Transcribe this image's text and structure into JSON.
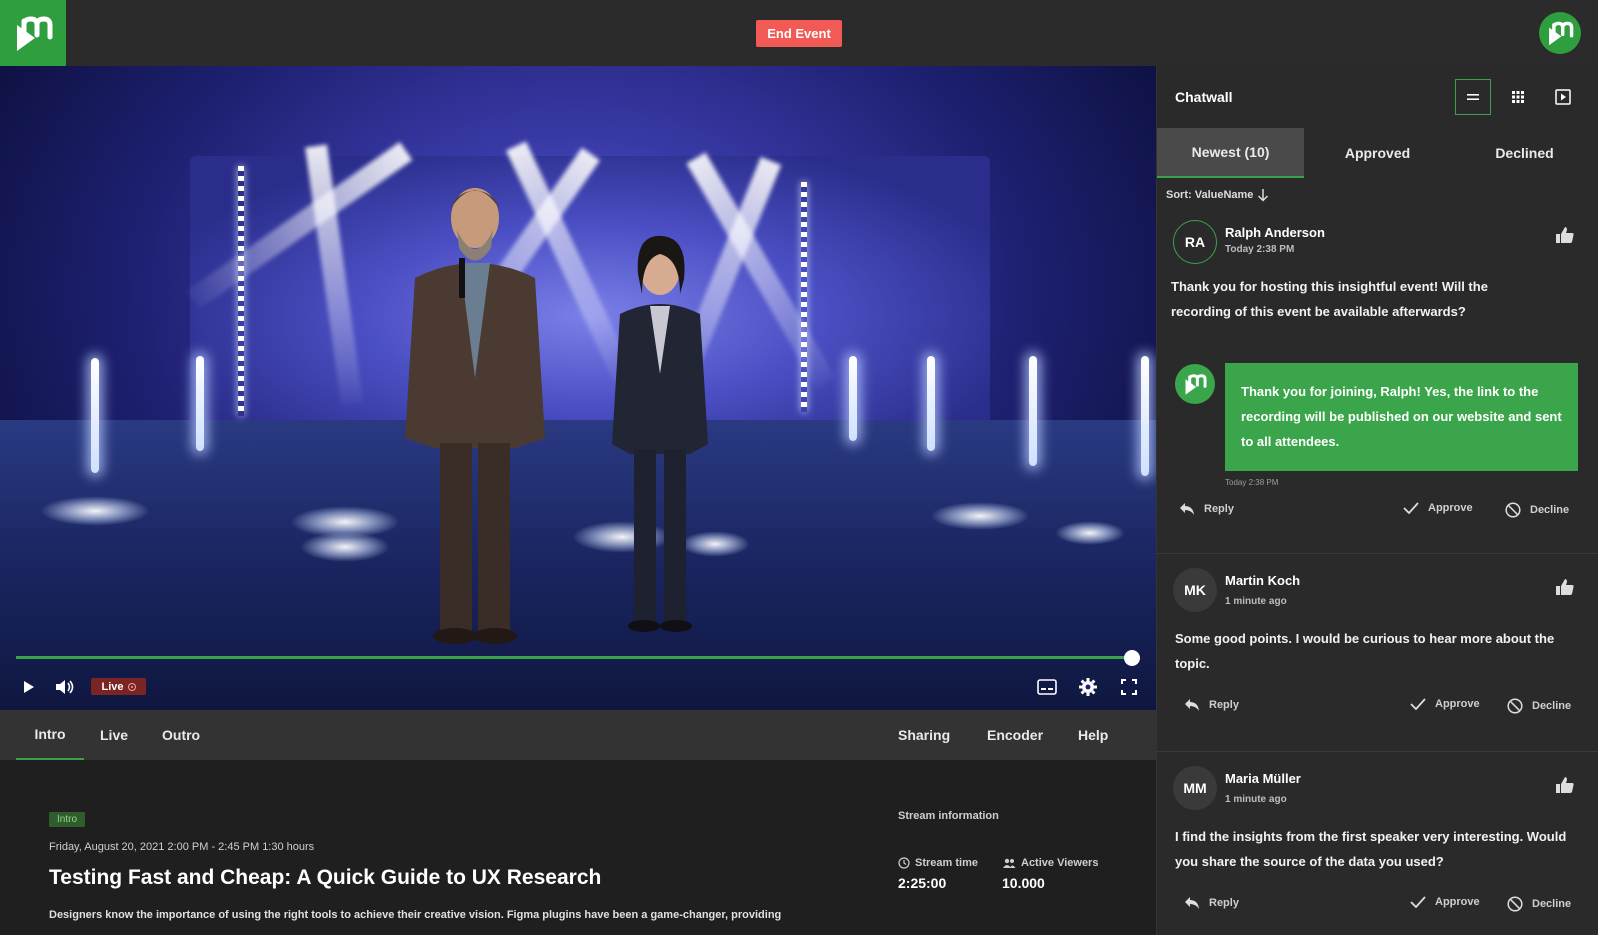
{
  "topbar": {
    "end_event_label": "End Event",
    "accent": "#2e9e3e",
    "end_color": "#f25a55"
  },
  "player": {
    "live_label": "Live",
    "progress": 0.99
  },
  "subnav": {
    "left_tabs": [
      "Intro",
      "Live",
      "Outro"
    ],
    "right_tabs": [
      "Sharing",
      "Encoder",
      "Help"
    ],
    "active": "Intro"
  },
  "event": {
    "tag": "Intro",
    "date": "Friday, August 20, 2021 2:00 PM - 2:45 PM 1:30 hours",
    "title": "Testing Fast and Cheap: A Quick Guide to UX Research",
    "description": "Designers know the importance of using the right tools to achieve their creative vision. Figma plugins have been a game-changer, providing"
  },
  "stream": {
    "heading": "Stream information",
    "time_label": "Stream time",
    "time_value": "2:25:00",
    "viewers_label": "Active Viewers",
    "viewers_value": "10.000"
  },
  "chat": {
    "title": "Chatwall",
    "tabs": [
      "Newest (10)",
      "Approved",
      "Declined"
    ],
    "sort_label": "Sort: ValueName",
    "actions": {
      "reply": "Reply",
      "approve": "Approve",
      "decline": "Decline"
    },
    "messages": [
      {
        "initials": "RA",
        "name": "Ralph Anderson",
        "time": "Today 2:38 PM",
        "text": "Thank you for hosting this insightful event! Will the recording of this event be available afterwards?",
        "reply": {
          "text": "Thank you for joining, Ralph! Yes, the link to the recording will be published on our website and sent to all attendees.",
          "time": "Today 2:38 PM"
        }
      },
      {
        "initials": "MK",
        "name": "Martin Koch",
        "time": "1 minute ago",
        "text": "Some good points. I would be curious to hear more about the topic."
      },
      {
        "initials": "MM",
        "name": "Maria Müller",
        "time": "1 minute ago",
        "text": "I find the insights from the first speaker very interesting. Would you share the source of the data you used?"
      }
    ]
  }
}
